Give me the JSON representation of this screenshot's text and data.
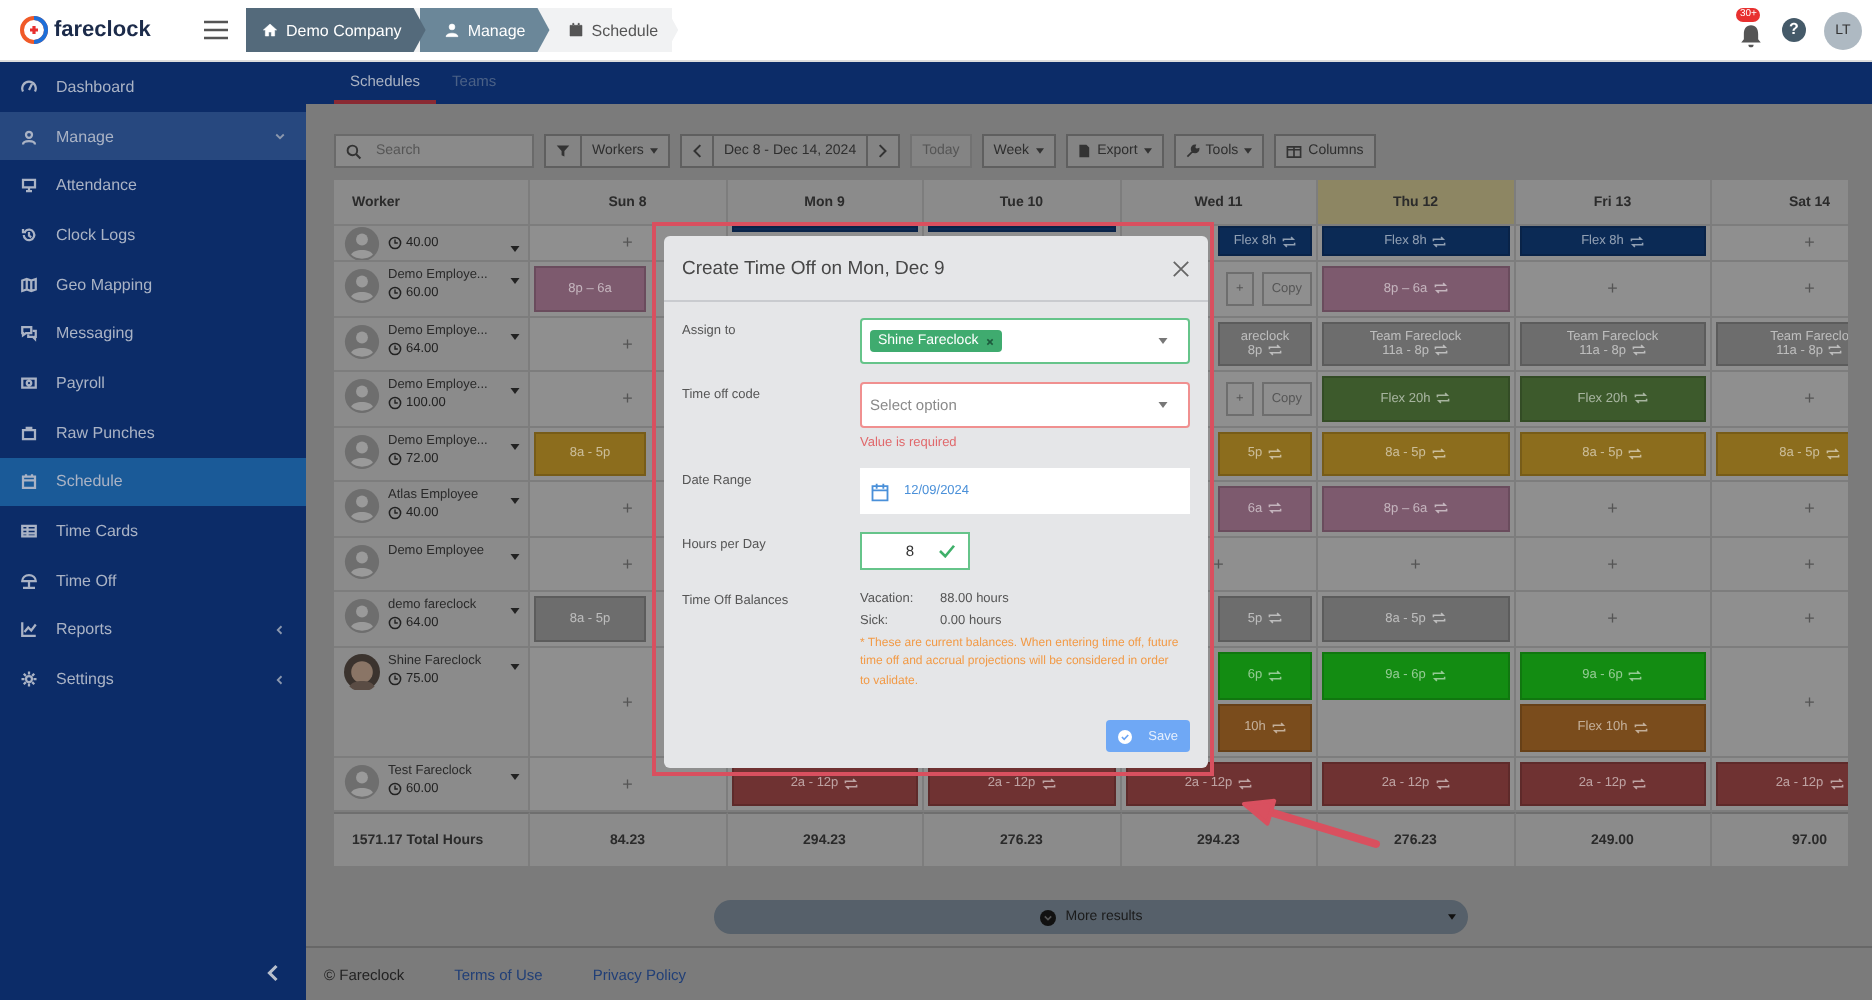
{
  "brand": {
    "name": "fareclock"
  },
  "breadcrumbs": [
    {
      "label": "Demo Company",
      "kind": "home"
    },
    {
      "label": "Manage",
      "kind": "user"
    },
    {
      "label": "Schedule",
      "kind": "calendar"
    }
  ],
  "header": {
    "notifications": "30+",
    "help": "?",
    "user_initials": "LT"
  },
  "sidebar": {
    "items": [
      {
        "label": "Dashboard",
        "kind": "link",
        "selected": false
      },
      {
        "label": "Manage",
        "kind": "group",
        "expanded": true,
        "selected": false
      },
      {
        "label": "Attendance",
        "kind": "link",
        "selected": false
      },
      {
        "label": "Clock Logs",
        "kind": "link",
        "selected": false
      },
      {
        "label": "Geo Mapping",
        "kind": "link",
        "selected": false
      },
      {
        "label": "Messaging",
        "kind": "link",
        "selected": false
      },
      {
        "label": "Payroll",
        "kind": "link",
        "selected": false
      },
      {
        "label": "Raw Punches",
        "kind": "link",
        "selected": false
      },
      {
        "label": "Schedule",
        "kind": "link",
        "selected": true
      },
      {
        "label": "Time Cards",
        "kind": "link",
        "selected": false
      },
      {
        "label": "Time Off",
        "kind": "link",
        "selected": false
      },
      {
        "label": "Reports",
        "kind": "group",
        "expanded": false,
        "selected": false
      },
      {
        "label": "Settings",
        "kind": "group",
        "expanded": false,
        "selected": false
      }
    ]
  },
  "tabs": [
    {
      "label": "Schedules",
      "selected": true
    },
    {
      "label": "Teams",
      "selected": false
    }
  ],
  "toolbar": {
    "search_placeholder": "Search",
    "workers": "Workers",
    "range": "Dec 8 - Dec 14, 2024",
    "today": "Today",
    "view": "Week",
    "export": "Export",
    "tools": "Tools",
    "columns": "Columns"
  },
  "table": {
    "worker_column": "Worker",
    "columns": [
      {
        "label": "Sun 8",
        "highlighted": false
      },
      {
        "label": "Mon 9",
        "highlighted": false
      },
      {
        "label": "Tue 10",
        "highlighted": false
      },
      {
        "label": "Wed 11",
        "highlighted": false
      },
      {
        "label": "Thu 12",
        "highlighted": true
      },
      {
        "label": "Fri 13",
        "highlighted": false
      },
      {
        "label": "Sat 14",
        "highlighted": false
      }
    ],
    "rows": [
      {
        "hours": "40.00",
        "photo": false,
        "cells": [
          {
            "kind": "add",
            "label": "+"
          },
          {
            "kind": "shift",
            "color": "#0b2a55"
          },
          {
            "kind": "shift",
            "color": "#0b2a55"
          },
          {
            "kind": "shift",
            "color": "#0b2a55",
            "text": "Flex 8h",
            "repeat": true
          },
          {
            "kind": "shift",
            "color": "#0b2a55",
            "text": "Flex 8h",
            "repeat": true
          },
          {
            "kind": "shift",
            "color": "#0b2a55",
            "text": "Flex 8h",
            "repeat": true
          },
          {
            "kind": "add",
            "label": "+"
          }
        ]
      },
      {
        "name": "Demo Employe...",
        "hours": "60.00",
        "photo": false,
        "cells": [
          {
            "kind": "shift",
            "color": "#7d5a6e",
            "text": "8p – 6a",
            "repeat": false
          },
          {
            "kind": "none"
          },
          {
            "kind": "none"
          },
          {
            "kind": "copy",
            "plus": "+",
            "label": "Copy"
          },
          {
            "kind": "shift",
            "color": "#7d5a6e",
            "text": "8p – 6a",
            "repeat": true
          },
          {
            "kind": "add",
            "label": "+"
          },
          {
            "kind": "add",
            "label": "+"
          }
        ]
      },
      {
        "name": "Demo Employe...",
        "hours": "64.00",
        "photo": false,
        "cells": [
          {
            "kind": "add",
            "label": "+"
          },
          {
            "kind": "none"
          },
          {
            "kind": "none"
          },
          {
            "kind": "shift",
            "color": "#6d6d6d",
            "text": "areclock",
            "sub": "8p",
            "repeat": true
          },
          {
            "kind": "shift",
            "color": "#6d6d6d",
            "text": "Team Fareclock",
            "sub": "11a - 8p",
            "repeat": true
          },
          {
            "kind": "shift",
            "color": "#6d6d6d",
            "text": "Team Fareclock",
            "sub": "11a - 8p",
            "repeat": true
          },
          {
            "kind": "shift",
            "color": "#6d6d6d",
            "text": "Team Fareclo",
            "sub": "11a - 8p",
            "repeat": true
          }
        ]
      },
      {
        "name": "Demo Employe...",
        "hours": "100.00",
        "photo": false,
        "cells": [
          {
            "kind": "add",
            "label": "+"
          },
          {
            "kind": "none"
          },
          {
            "kind": "none"
          },
          {
            "kind": "copy",
            "plus": "+",
            "label": "Copy"
          },
          {
            "kind": "shift",
            "color": "#3d5a2c",
            "text": "Flex 20h",
            "repeat": true
          },
          {
            "kind": "shift",
            "color": "#3d5a2c",
            "text": "Flex 20h",
            "repeat": true
          },
          {
            "kind": "add",
            "label": "+"
          }
        ]
      },
      {
        "name": "Demo Employe...",
        "hours": "72.00",
        "photo": false,
        "cells": [
          {
            "kind": "shift",
            "color": "#8c6d1d",
            "text": "8a - 5p",
            "repeat": false
          },
          {
            "kind": "none"
          },
          {
            "kind": "none"
          },
          {
            "kind": "shift",
            "color": "#8c6d1d",
            "text": "5p",
            "repeat": true
          },
          {
            "kind": "shift",
            "color": "#8c6d1d",
            "text": "8a - 5p",
            "repeat": true
          },
          {
            "kind": "shift",
            "color": "#8c6d1d",
            "text": "8a - 5p",
            "repeat": true
          },
          {
            "kind": "shift",
            "color": "#8c6d1d",
            "text": "8a - 5p",
            "repeat": true
          }
        ]
      },
      {
        "name": "Atlas Employee",
        "hours": "40.00",
        "photo": false,
        "cells": [
          {
            "kind": "add",
            "label": "+"
          },
          {
            "kind": "none"
          },
          {
            "kind": "none"
          },
          {
            "kind": "shift",
            "color": "#7d5a6e",
            "text": "6a",
            "repeat": true
          },
          {
            "kind": "shift",
            "color": "#7d5a6e",
            "text": "8p – 6a",
            "repeat": true
          },
          {
            "kind": "add",
            "label": "+"
          },
          {
            "kind": "add",
            "label": "+"
          }
        ]
      },
      {
        "name": "Demo Employee",
        "photo": false,
        "cells": [
          {
            "kind": "add",
            "label": "+"
          },
          {
            "kind": "none"
          },
          {
            "kind": "none"
          },
          {
            "kind": "add",
            "label": "+"
          },
          {
            "kind": "add",
            "label": "+"
          },
          {
            "kind": "add",
            "label": "+"
          },
          {
            "kind": "add",
            "label": "+"
          }
        ]
      },
      {
        "name": "demo fareclock",
        "hours": "64.00",
        "photo": false,
        "cells": [
          {
            "kind": "shift",
            "color": "#6d6d6d",
            "text": "8a - 5p",
            "repeat": false
          },
          {
            "kind": "none"
          },
          {
            "kind": "none"
          },
          {
            "kind": "shift",
            "color": "#6d6d6d",
            "text": "5p",
            "repeat": true
          },
          {
            "kind": "shift",
            "color": "#6d6d6d",
            "text": "8a - 5p",
            "repeat": true
          },
          {
            "kind": "add",
            "label": "+"
          },
          {
            "kind": "add",
            "label": "+"
          }
        ]
      },
      {
        "name": "Shine Fareclock",
        "hours": "75.00",
        "photo": true,
        "cells": [
          {
            "kind": "add",
            "label": "+"
          },
          {
            "kind": "none"
          },
          {
            "kind": "none"
          },
          {
            "kind": "stack",
            "shifts": [
              {
                "color": "#138c12",
                "text": "6p",
                "repeat": true
              },
              {
                "color": "#7a4c1c",
                "text": "10h",
                "repeat": true
              }
            ]
          },
          {
            "kind": "stack",
            "shifts": [
              {
                "color": "#138c12",
                "text": "9a - 6p",
                "repeat": true
              }
            ]
          },
          {
            "kind": "stack",
            "shifts": [
              {
                "color": "#138c12",
                "text": "9a - 6p",
                "repeat": true
              },
              {
                "color": "#7a4c1c",
                "text": "Flex 10h",
                "repeat": true
              }
            ]
          },
          {
            "kind": "add",
            "label": "+"
          }
        ]
      },
      {
        "name": "Test Fareclock",
        "hours": "60.00",
        "photo": false,
        "cells": [
          {
            "kind": "add",
            "label": "+"
          },
          {
            "kind": "shift",
            "color": "#6f3232",
            "text": "2a - 12p",
            "repeat": true
          },
          {
            "kind": "shift",
            "color": "#6f3232",
            "text": "2a - 12p",
            "repeat": true
          },
          {
            "kind": "shift",
            "color": "#6f3232",
            "text": "2a - 12p",
            "repeat": true
          },
          {
            "kind": "shift",
            "color": "#6f3232",
            "text": "2a - 12p",
            "repeat": true
          },
          {
            "kind": "shift",
            "color": "#6f3232",
            "text": "2a - 12p",
            "repeat": true
          },
          {
            "kind": "shift",
            "color": "#6f3232",
            "text": "2a - 12p",
            "repeat": true
          }
        ]
      }
    ],
    "total_label": "1571.17 Total Hours",
    "totals": [
      "84.23",
      "294.23",
      "276.23",
      "294.23",
      "276.23",
      "249.00",
      "97.00"
    ]
  },
  "more_results": "More results",
  "footer": {
    "copyright": "© Fareclock",
    "links": [
      "Terms of Use",
      "Privacy Policy"
    ]
  },
  "dialog": {
    "title": "Create Time Off on Mon, Dec 9",
    "assign_to": {
      "label": "Assign to",
      "chip": "Shine Fareclock"
    },
    "time_off_code": {
      "label": "Time off code",
      "placeholder": "Select option",
      "error": "Value is required"
    },
    "date_range": {
      "label": "Date Range",
      "value": "12/09/2024"
    },
    "hours_per_day": {
      "label": "Hours per Day",
      "value": "8",
      "valid": true
    },
    "balances": {
      "label": "Time Off Balances",
      "items": [
        {
          "name": "Vacation:",
          "value": "88.00 hours"
        },
        {
          "name": "Sick:",
          "value": "0.00 hours"
        }
      ],
      "note": "* These are current balances. When entering time off, future time off and accrual projections will be considered in order to validate."
    },
    "save": {
      "label": "Save",
      "disabled": true
    }
  }
}
